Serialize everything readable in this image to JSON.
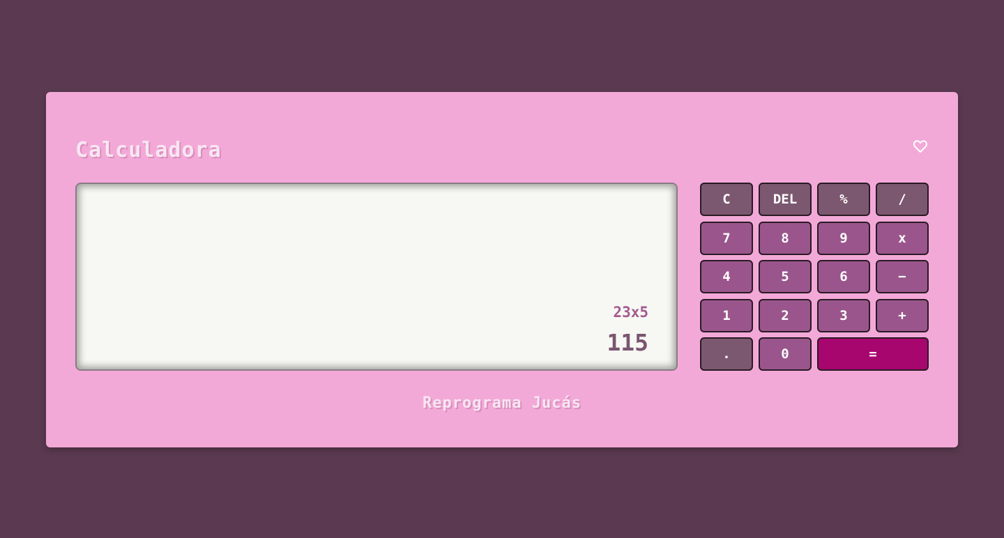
{
  "app": {
    "title": "Calculadora",
    "footer": "Reprograma Jucás"
  },
  "display": {
    "expression": "23x5",
    "result": "115"
  },
  "keys": {
    "clear": "C",
    "delete": "DEL",
    "percent": "%",
    "divide": "/",
    "seven": "7",
    "eight": "8",
    "nine": "9",
    "multiply": "x",
    "four": "4",
    "five": "5",
    "six": "6",
    "subtract": "−",
    "one": "1",
    "two": "2",
    "three": "3",
    "add": "+",
    "decimal": ".",
    "zero": "0",
    "equals": "="
  },
  "icons": {
    "favorite": "heart-icon"
  },
  "colors": {
    "background": "#5b3a51",
    "card": "#f3a9d8",
    "key_number": "#9a568c",
    "key_function": "#7c5870",
    "key_equals": "#a8066f",
    "display": "#f7f8f3"
  }
}
